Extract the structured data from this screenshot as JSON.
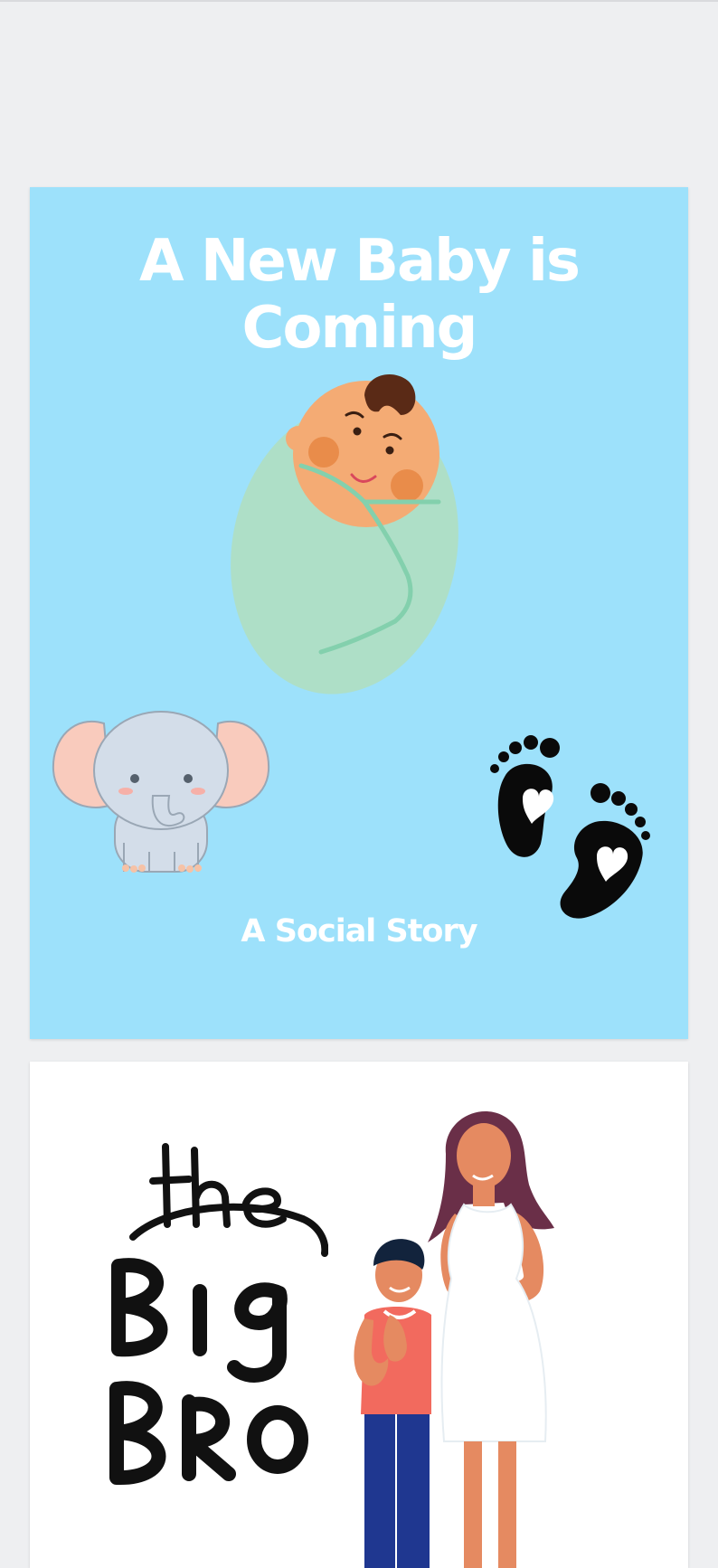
{
  "document": {
    "pages": [
      {
        "title": "A New Baby is Coming",
        "subtitle": "A Social Story",
        "illustrations": [
          "swaddled-baby",
          "baby-elephant",
          "baby-footprints"
        ]
      },
      {
        "illustrations": [
          "the-big-bro-lettering",
          "pregnant-mother-and-son"
        ]
      }
    ]
  },
  "colors": {
    "page_background": "#eeeff1",
    "cover_background": "#9de1fb",
    "swaddle_green": "#aedfc7",
    "skin": "#f4ab74"
  }
}
